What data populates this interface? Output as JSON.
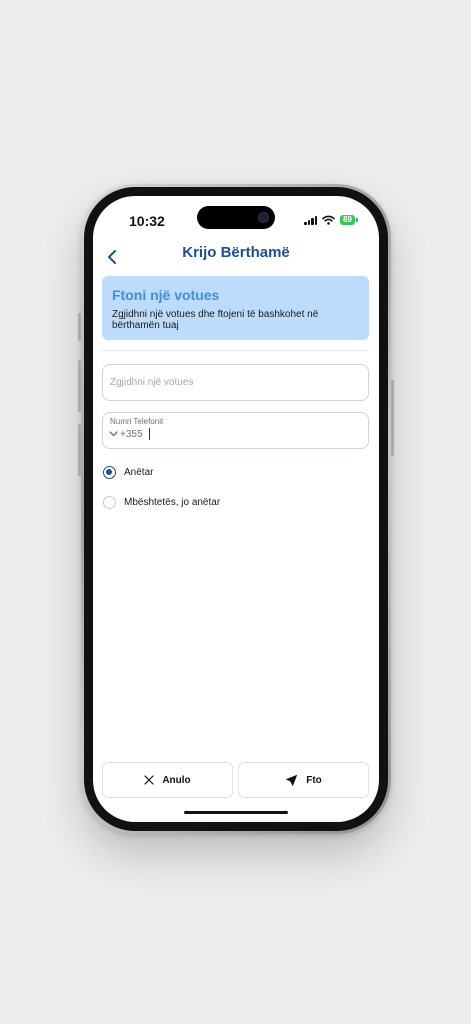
{
  "status_bar": {
    "time": "10:32",
    "battery": "89",
    "icons": [
      "signal-icon",
      "wifi-icon",
      "battery-icon"
    ]
  },
  "nav": {
    "title": "Krijo Bërthamë",
    "back_icon": "chevron-left-icon"
  },
  "info_card": {
    "title": "Ftoni një votues",
    "description": "Zgjidhni një votues dhe ftojeni të bashkohet në bërthamën tuaj"
  },
  "form": {
    "voter_select": {
      "placeholder": "Zgjidhni një votues"
    },
    "phone": {
      "label": "Numri Telefonit",
      "country_code": "+355",
      "value": ""
    }
  },
  "membership": {
    "options": [
      {
        "label": "Anëtar",
        "selected": true
      },
      {
        "label": "Mbështetës, jo anëtar",
        "selected": false
      }
    ]
  },
  "actions": {
    "cancel_label": "Anulo",
    "cancel_icon": "close-icon",
    "invite_label": "Fto",
    "invite_icon": "send-icon"
  },
  "colors": {
    "accent": "#1d4f91",
    "card_bg": "#bddbfb",
    "card_title": "#3c8ee8",
    "battery": "#35c759"
  }
}
